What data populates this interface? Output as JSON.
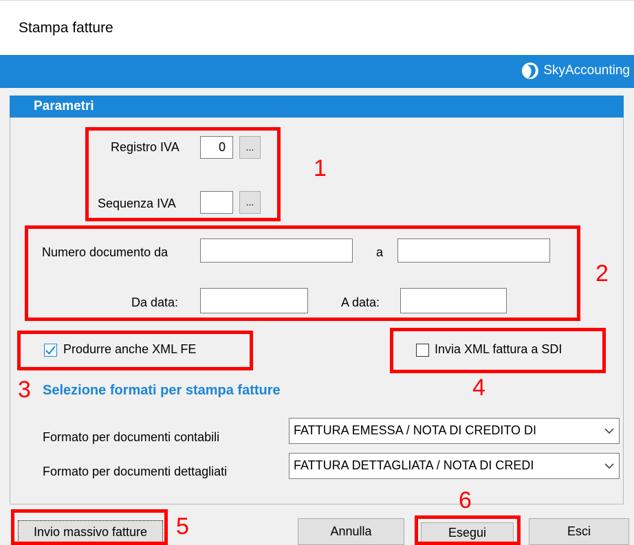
{
  "window": {
    "title": "Stampa fatture"
  },
  "brand": {
    "name": "SkyAccounting",
    "icon": "skyaccounting-logo-icon",
    "bar_color": "#1b86d7"
  },
  "panel": {
    "header": "Parametri"
  },
  "registro": {
    "label": "Registro IVA",
    "value": "0",
    "browse_label": "..."
  },
  "sequenza": {
    "label": "Sequenza IVA",
    "value": "",
    "browse_label": "..."
  },
  "numero": {
    "label_da": "Numero documento da",
    "value_da": "",
    "label_a": "a",
    "value_a": ""
  },
  "date": {
    "label_da": "Da data:",
    "value_da": "",
    "label_a": "A data:",
    "value_a": ""
  },
  "xml_fe": {
    "label": "Produrre anche XML FE",
    "checked": true
  },
  "sdi": {
    "label": "Invia XML fattura a SDI",
    "checked": false
  },
  "formats": {
    "title": "Selezione formati per stampa fatture",
    "contabili_label": "Formato per documenti contabili",
    "contabili_value": "FATTURA EMESSA / NOTA DI CREDITO DI",
    "dettagliati_label": "Formato per documenti dettagliati",
    "dettagliati_value": "FATTURA DETTAGLIATA / NOTA DI CREDI"
  },
  "buttons": {
    "invio": "Invio massivo fatture",
    "annulla": "Annulla",
    "esegui": "Esegui",
    "esci": "Esci"
  },
  "annotations": {
    "n1": "1",
    "n2": "2",
    "n3": "3",
    "n4": "4",
    "n5": "5",
    "n6": "6",
    "color": "#ff0000"
  }
}
